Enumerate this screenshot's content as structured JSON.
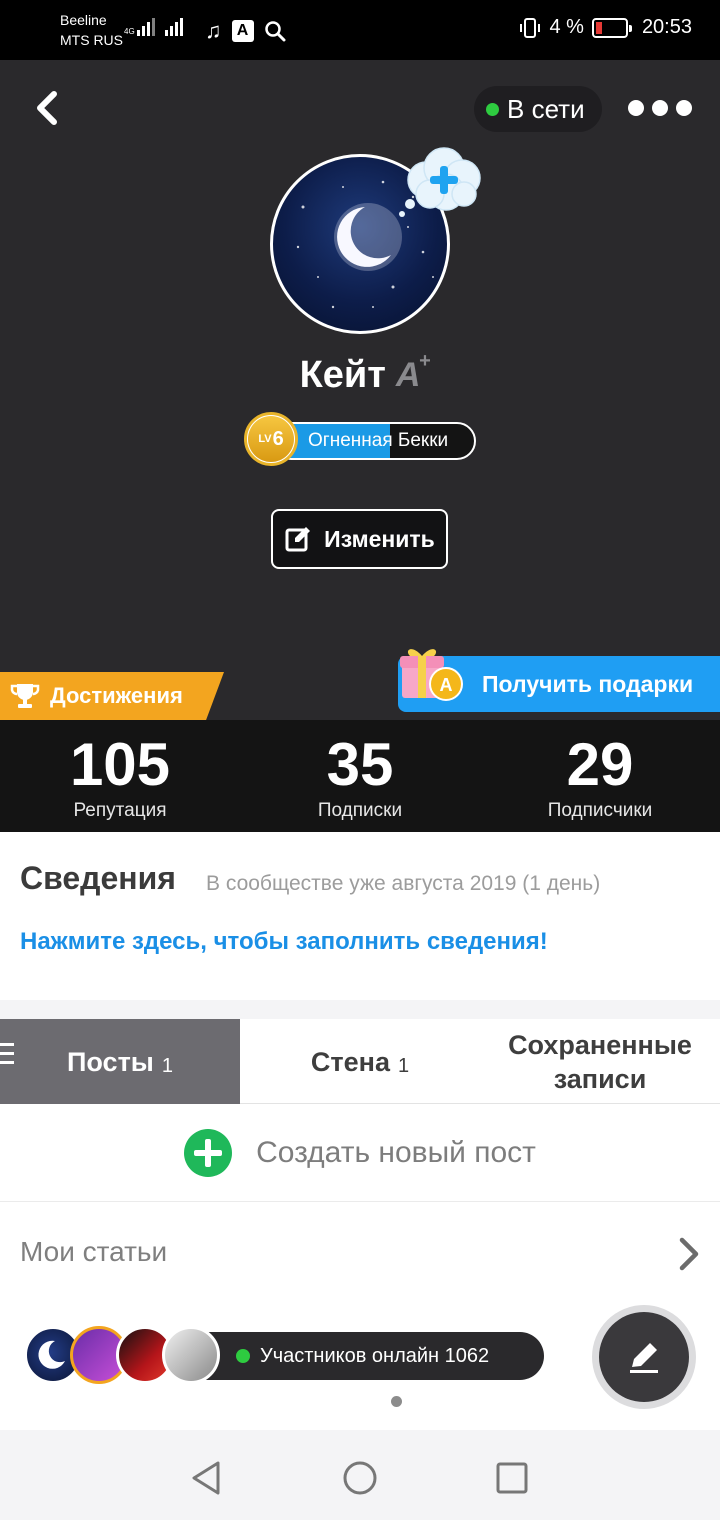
{
  "status_bar": {
    "carrier1": "Beeline",
    "carrier2": "MTS RUS",
    "network_type": "4G",
    "battery": "4 %",
    "time": "20:53",
    "battery_color": "#e53935"
  },
  "header": {
    "online_label": "В сети",
    "online_color": "#2ecc40",
    "username": "Кейт",
    "level": "6",
    "level_prefix": "LV",
    "level_title": "Огненная Бекки",
    "level_progress": 0.58,
    "edit_label": "Изменить",
    "achievements_label": "Достижения",
    "gifts_label": "Получить подарки"
  },
  "stats": [
    {
      "value": "105",
      "label": "Репутация"
    },
    {
      "value": "35",
      "label": "Подписки"
    },
    {
      "value": "29",
      "label": "Подписчики"
    }
  ],
  "info": {
    "title": "Сведения",
    "since": "В сообществе уже августа 2019 (1 день)",
    "fill_link": "Нажмите здесь, чтобы заполнить сведения!"
  },
  "tabs": [
    {
      "label": "Посты",
      "count": "1",
      "active": true
    },
    {
      "label": "Стена",
      "count": "1",
      "active": false
    },
    {
      "label": "Сохраненные записи",
      "count": "",
      "active": false
    }
  ],
  "create_post_label": "Создать новый пост",
  "articles_label": "Мои статьи",
  "members_online_label": "Участников онлайн 1062",
  "colors": {
    "header_bg": "#2a292c",
    "accent_blue": "#1f9ef3",
    "achievements_orange": "#f3a51f",
    "create_green": "#1fb85a",
    "link_blue": "#1a8fe6"
  }
}
